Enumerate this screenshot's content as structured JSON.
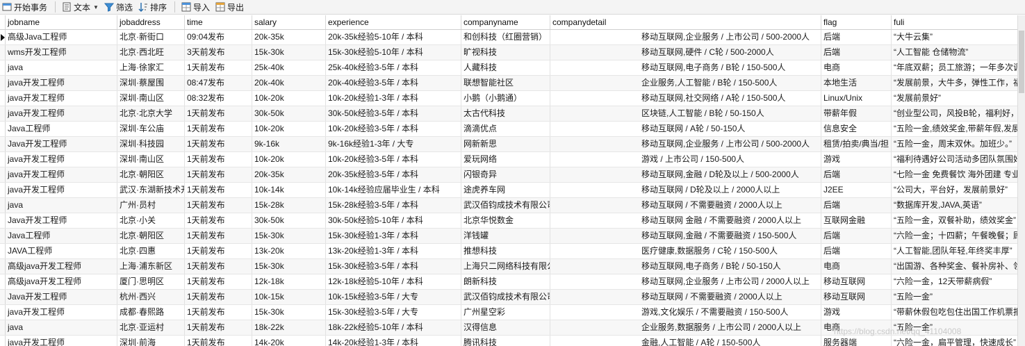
{
  "toolbar": {
    "begin_transaction": "开始事务",
    "text": "文本",
    "filter": "筛选",
    "sort": "排序",
    "import": "导入",
    "export": "导出"
  },
  "columns": [
    "jobname",
    "jobaddress",
    "time",
    "salary",
    "experience",
    "companyname",
    "companydetail",
    "flag",
    "fuli"
  ],
  "rows": [
    [
      "高级Java工程师",
      "北京·新街口",
      "09:04发布",
      "20k-35k",
      "20k-35k经验5-10年 / 本科",
      "和创科技（红圈营销）",
      "移动互联网,企业服务 / 上市公司 / 500-2000人",
      "后端",
      "“大牛云集”"
    ],
    [
      "wms开发工程师",
      "北京·西北旺",
      "3天前发布",
      "15k-30k",
      "15k-30k经验5-10年 / 本科",
      "旷视科技",
      "移动互联网,硬件 / C轮 / 500-2000人",
      "后端",
      "“人工智能 仓储物流”"
    ],
    [
      "java",
      "上海·徐家汇",
      "1天前发布",
      "25k-40k",
      "25k-40k经验3-5年 / 本科",
      "人藏科技",
      "移动互联网,电子商务 / B轮 / 150-500人",
      "电商",
      "“年底双薪；员工旅游；一年多次调"
    ],
    [
      "java开发工程师",
      "深圳·蔡屋围",
      "08:47发布",
      "20k-40k",
      "20k-40k经验3-5年 / 本科",
      "联想智能社区",
      "企业服务,人工智能 / B轮 / 150-500人",
      "本地生活",
      "“发展前景，大牛多，弹性工作，福"
    ],
    [
      "java开发工程师",
      "深圳·南山区",
      "08:32发布",
      "10k-20k",
      "10k-20k经验1-3年 / 本科",
      "小鹅（小鹅通）",
      "移动互联网,社交网络 / A轮 / 150-500人",
      "Linux/Unix",
      "“发展前景好”"
    ],
    [
      "java开发工程师",
      "北京·北京大学",
      "1天前发布",
      "30k-50k",
      "30k-50k经验3-5年 / 本科",
      "太古代科技",
      "区块链,人工智能 / B轮 / 50-150人",
      "带薪年假",
      "“创业型公司，风投B轮，福利好，"
    ],
    [
      "Java工程师",
      "深圳·车公庙",
      "1天前发布",
      "10k-20k",
      "10k-20k经验3-5年 / 本科",
      "滴滴优点",
      "移动互联网 / A轮 / 50-150人",
      "信息安全",
      "“五险一金,绩效奖金,带薪年假,发展"
    ],
    [
      "Java开发工程师",
      "深圳·科技园",
      "1天前发布",
      "9k-16k",
      "9k-16k经验1-3年 / 大专",
      "网新新思",
      "移动互联网,企业服务 / 上市公司 / 500-2000人",
      "租赁/拍卖/典当/担",
      "“五险一金，周末双休。加班少。”"
    ],
    [
      "java开发工程师",
      "深圳·南山区",
      "1天前发布",
      "10k-20k",
      "10k-20k经验3-5年 / 本科",
      "爱玩网络",
      "游戏 / 上市公司 / 150-500人",
      "游戏",
      "“福利待遇好公司活动多团队氛围好"
    ],
    [
      "java开发工程师",
      "北京·朝阳区",
      "1天前发布",
      "20k-35k",
      "20k-35k经验3-5年 / 本科",
      "闪银奇异",
      "移动互联网,金融 / D轮及以上 / 500-2000人",
      "后端",
      "“七险一金 免费餐饮 海外团建 专业"
    ],
    [
      "java开发工程师",
      "武汉·东湖新技术开发区",
      "1天前发布",
      "10k-14k",
      "10k-14k经验应届毕业生 / 本科",
      "途虎养车网",
      "移动互联网 / D轮及以上 / 2000人以上",
      "J2EE",
      "“公司大，平台好，发展前景好”"
    ],
    [
      "java",
      "广州·员村",
      "1天前发布",
      "15k-28k",
      "15k-28k经验3-5年 / 本科",
      "武汉佰钧成技术有限公司",
      "移动互联网 / 不需要融资 / 2000人以上",
      "后端",
      "“数据库开发,JAVA,英语”"
    ],
    [
      "Java开发工程师",
      "北京·小关",
      "1天前发布",
      "30k-50k",
      "30k-50k经验5-10年 / 本科",
      "北京华悦数金",
      "移动互联网 金融 / 不需要融资 / 2000人以上",
      "互联网金融",
      "“五险一金，双餐补助，绩效奖金”"
    ],
    [
      "Java工程师",
      "北京·朝阳区",
      "1天前发布",
      "15k-30k",
      "15k-30k经验1-3年 / 本科",
      "洋钱罐",
      "移动互联网,金融 / 不需要融资 / 150-500人",
      "后端",
      "“六险一金；十四薪；午餐晚餐；顾"
    ],
    [
      "JAVA工程师",
      "北京·四惠",
      "1天前发布",
      "13k-20k",
      "13k-20k经验1-3年 / 本科",
      "推想科技",
      "医疗健康,数据服务 / C轮 / 150-500人",
      "后端",
      "“人工智能,团队年轻,年终奖丰厚”"
    ],
    [
      "高级java开发工程师",
      "上海·浦东新区",
      "1天前发布",
      "15k-30k",
      "15k-30k经验3-5年 / 本科",
      "上海只二网络科技有限公司",
      "移动互联网,电子商务 / B轮 / 50-150人",
      "电商",
      "“出国游、各种奖金、餐补房补、领"
    ],
    [
      "高级java开发工程师",
      "厦门·思明区",
      "1天前发布",
      "12k-18k",
      "12k-18k经验5-10年 / 本科",
      "朗新科技",
      "移动互联网,企业服务 / 上市公司 / 2000人以上",
      "移动互联网",
      "“六险一金，12天带薪病假”"
    ],
    [
      "Java开发工程师",
      "杭州·西兴",
      "1天前发布",
      "10k-15k",
      "10k-15k经验3-5年 / 大专",
      "武汉佰钧成技术有限公司",
      "移动互联网 / 不需要融资 / 2000人以上",
      "移动互联网",
      "“五险一金”"
    ],
    [
      "java开发工程师",
      "成都·春熙路",
      "1天前发布",
      "15k-30k",
      "15k-30k经验3-5年 / 大专",
      "广州星空彩",
      "游戏,文化娱乐 / 不需要融资 / 150-500人",
      "游戏",
      "“带薪休假包吃包住出国工作机票报"
    ],
    [
      "java",
      "北京·亚运村",
      "1天前发布",
      "18k-22k",
      "18k-22k经验5-10年 / 本科",
      "汉得信息",
      "企业服务,数据服务 / 上市公司 / 2000人以上",
      "电商",
      "“五险一金”"
    ],
    [
      "java开发工程师",
      "深圳·前海",
      "1天前发布",
      "14k-20k",
      "14k-20k经验1-3年 / 本科",
      "腾讯科技",
      "金融,人工智能 / A轮 / 150-500人",
      "服务器端",
      "“六险一金，扁平管理，快速成长”"
    ]
  ],
  "watermark": "https://blog.csdn.net/qq_41104008"
}
